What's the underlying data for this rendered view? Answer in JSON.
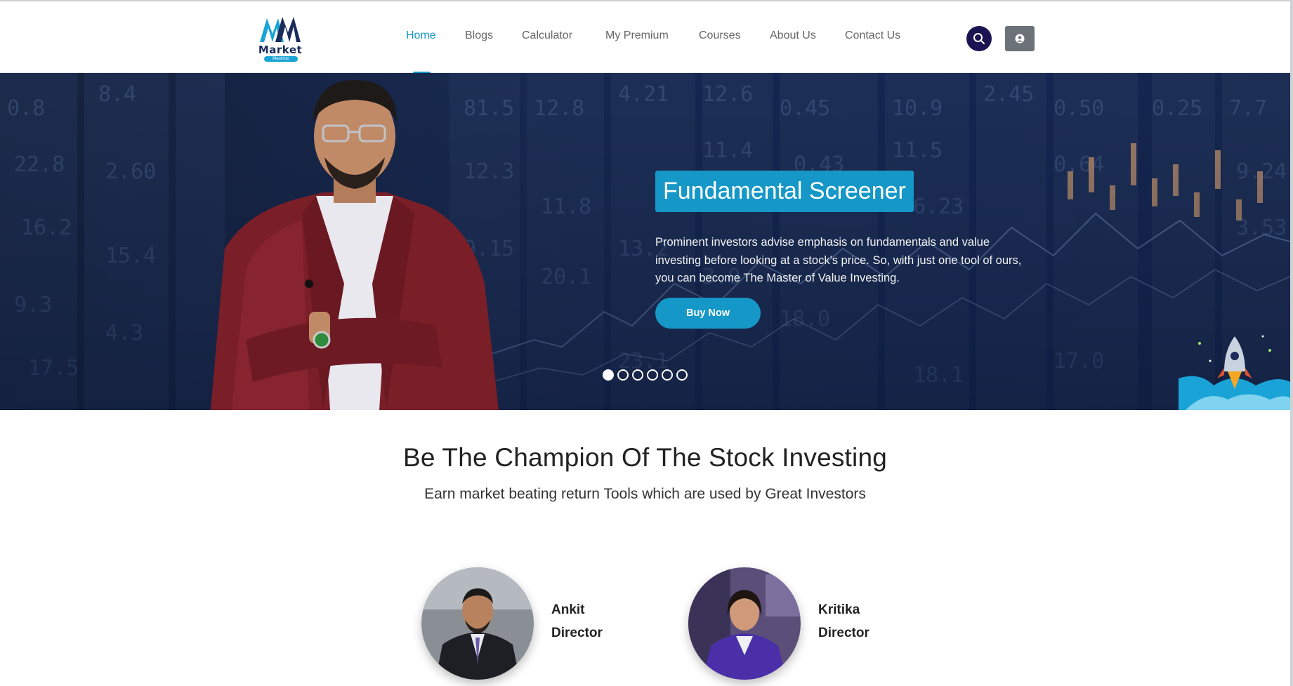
{
  "brand": {
    "logo_text": "Market",
    "logo_sub": "Mastroo",
    "colors": {
      "accent": "#1597c7",
      "navy": "#1a1552",
      "gray_button": "#6b7278"
    }
  },
  "nav": {
    "items": [
      {
        "label": "Home",
        "active": true
      },
      {
        "label": "Blogs"
      },
      {
        "label": "Calculator"
      },
      {
        "label": "My Premium"
      },
      {
        "label": "Courses"
      },
      {
        "label": "About Us"
      },
      {
        "label": "Contact Us"
      }
    ],
    "search_icon": "search-icon",
    "user_icon": "user-icon"
  },
  "hero": {
    "title": "Fundamental Screener",
    "description": "Prominent investors advise emphasis on fundamentals and value investing before looking at a stock's price. So, with just one tool of ours, you can become The Master of Value Investing.",
    "cta": "Buy Now",
    "slides_total": 6,
    "active_slide": 1
  },
  "section": {
    "title": "Be The Champion Of The Stock Investing",
    "subtitle": "Earn market beating return Tools which are used by Great Investors"
  },
  "team": [
    {
      "name": "Ankit",
      "role": "Director"
    },
    {
      "name": "Kritika",
      "role": "Director"
    }
  ]
}
